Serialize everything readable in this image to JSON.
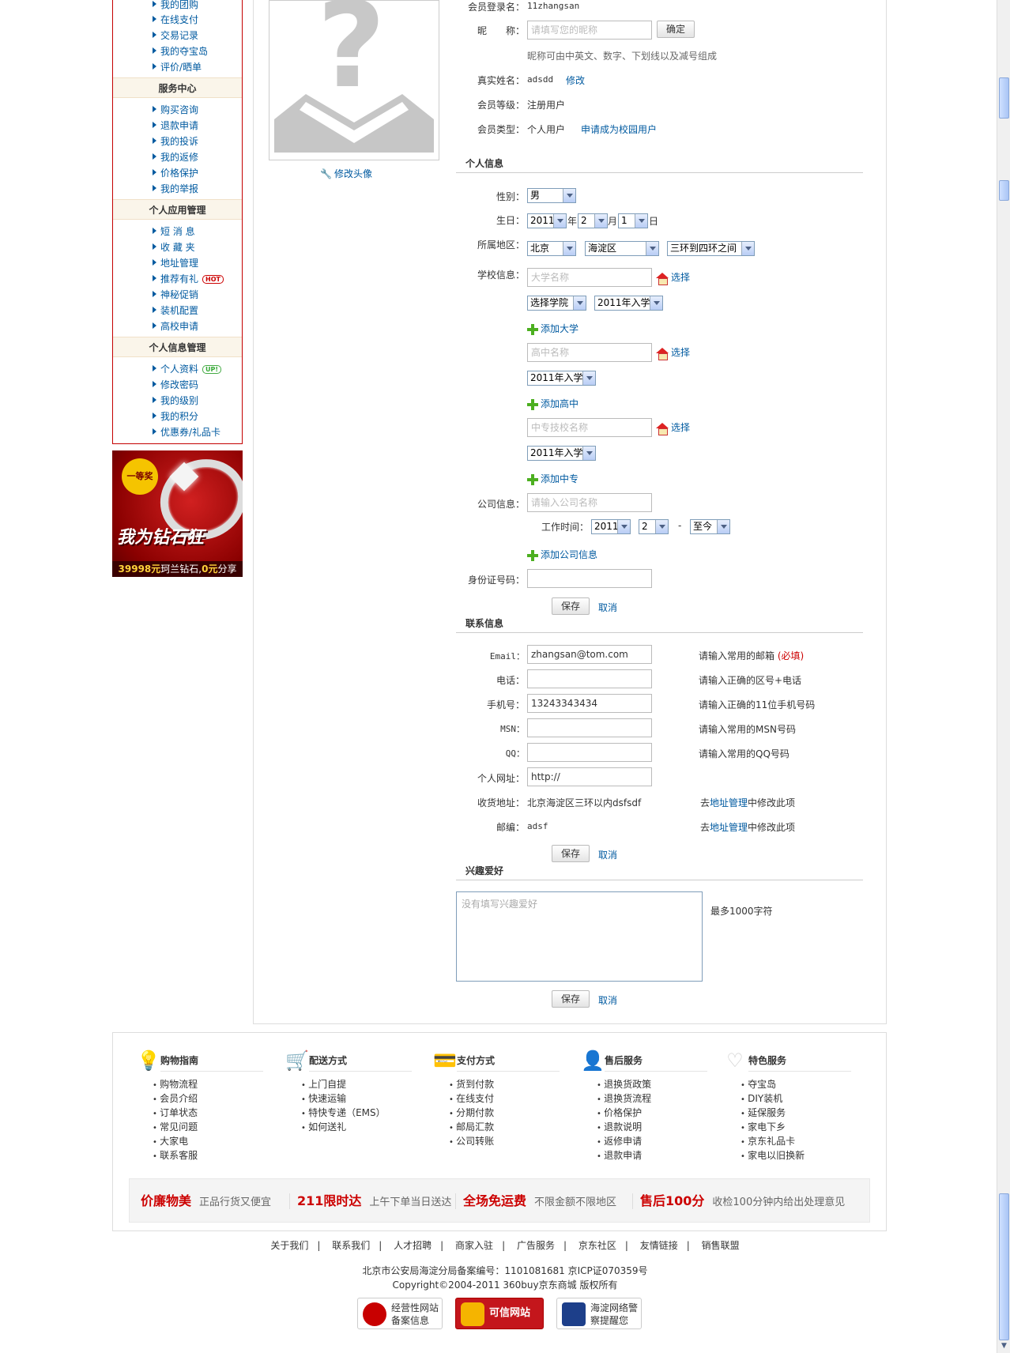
{
  "sidebar": {
    "group0": [
      "我的团购",
      "在线支付",
      "交易记录",
      "我的夺宝岛",
      "评价/晒单"
    ],
    "service_title": "服务中心",
    "service": [
      "购买咨询",
      "退款申请",
      "我的投诉",
      "我的返修",
      "价格保护",
      "我的举报"
    ],
    "app_title": "个人应用管理",
    "app": [
      "短 消 息",
      "收 藏 夹",
      "地址管理",
      "推荐有礼",
      "神秘促销",
      "装机配置",
      "高校申请"
    ],
    "hot_badge": "HOT",
    "info_title": "个人信息管理",
    "info": [
      "个人资料",
      "修改密码",
      "我的级别",
      "我的积分",
      "优惠券/礼品卡"
    ],
    "up_badge": "UP!"
  },
  "ad": {
    "prize": "一等奖",
    "slogan": "我为钻石狂",
    "price": "39998元",
    "mid": "珂兰钻石,",
    "zero": "0元",
    "share": "分享"
  },
  "avatar": {
    "edit_label": "修改头像"
  },
  "account": {
    "login_label": "会员登录名：",
    "login_value": "11zhangsan",
    "nick_label": "昵　　称：",
    "nick_placeholder": "请填写您的昵称",
    "confirm_button": "确定",
    "nick_hint": "昵称可由中英文、数字、下划线以及减号组成",
    "realname_label": "真实姓名：",
    "realname_value": "adsdd",
    "realname_edit": "修改",
    "level_label": "会员等级：",
    "level_value": "注册用户",
    "type_label": "会员类型：",
    "type_value": "个人用户",
    "campus_link": "申请成为校园用户"
  },
  "personal": {
    "title": "个人信息",
    "gender_label": "性别：",
    "gender_value": "男",
    "birthday_label": "生日：",
    "year": "2011",
    "year_unit": "年",
    "month": "2",
    "month_unit": "月",
    "day": "1",
    "day_unit": "日",
    "region_label": "所属地区：",
    "province": "北京",
    "district": "海淀区",
    "area": "三环到四环之间",
    "school_label": "学校信息：",
    "university_placeholder": "大学名称",
    "choose": "选择",
    "college_select": "选择学院",
    "entry_year": "2011年入学",
    "add_university": "添加大学",
    "highschool_placeholder": "高中名称",
    "add_highschool": "添加高中",
    "vocational_placeholder": "中专技校名称",
    "add_vocational": "添加中专",
    "company_label": "公司信息：",
    "company_placeholder": "请输入公司名称",
    "worktime_label": "工作时间：",
    "work_year": "2011",
    "work_month": "2",
    "work_to": "至今",
    "dash": "-",
    "add_company": "添加公司信息",
    "id_label": "身份证号码：",
    "save": "保存",
    "cancel": "取消"
  },
  "contact": {
    "title": "联系信息",
    "email_label": "Email：",
    "email_value": "zhangsan@tom.com",
    "email_hint": "请输入常用的邮箱",
    "required": "(必填)",
    "phone_label": "电话：",
    "phone_hint": "请输入正确的区号+电话",
    "mobile_label": "手机号：",
    "mobile_value": "13243343434",
    "mobile_hint": "请输入正确的11位手机号码",
    "msn_label": "MSN：",
    "msn_hint": "请输入常用的MSN号码",
    "qq_label": "QQ：",
    "qq_hint": "请输入常用的QQ号码",
    "web_label": "个人网址：",
    "web_value": "http://",
    "address_label": "收货地址：",
    "address_value": "北京海淀区三环以内dsfsdf",
    "goto": "去",
    "address_mgmt": "地址管理",
    "edit_here": "中修改此项",
    "zip_label": "邮编：",
    "zip_value": "adsf",
    "save": "保存",
    "cancel": "取消"
  },
  "hobby": {
    "title": "兴趣爱好",
    "placeholder": "没有填写兴趣爱好",
    "limit": "最多1000字符",
    "save": "保存",
    "cancel": "取消"
  },
  "footer": {
    "cols": [
      {
        "title": "购物指南",
        "items": [
          "购物流程",
          "会员介绍",
          "订单状态",
          "常见问题",
          "大家电",
          "联系客服"
        ]
      },
      {
        "title": "配送方式",
        "items": [
          "上门自提",
          "快速运输",
          "特快专递（EMS）",
          "如何送礼"
        ]
      },
      {
        "title": "支付方式",
        "items": [
          "货到付款",
          "在线支付",
          "分期付款",
          "邮局汇款",
          "公司转账"
        ]
      },
      {
        "title": "售后服务",
        "items": [
          "退换货政策",
          "退换货流程",
          "价格保护",
          "退款说明",
          "返修申请",
          "退款申请"
        ]
      },
      {
        "title": "特色服务",
        "items": [
          "夺宝岛",
          "DIY装机",
          "延保服务",
          "家电下乡",
          "京东礼品卡",
          "家电以旧换新"
        ]
      }
    ],
    "promos": [
      {
        "bold": "价廉物美",
        "text": "正品行货又便宜"
      },
      {
        "bold": "211限时达",
        "text": "上午下单当日送达"
      },
      {
        "bold": "全场免运费",
        "text": "不限金额不限地区"
      },
      {
        "bold": "售后100分",
        "text": "收检100分钟内给出处理意见"
      }
    ],
    "links": [
      "关于我们",
      "联系我们",
      "人才招聘",
      "商家入驻",
      "广告服务",
      "京东社区",
      "友情链接",
      "销售联盟"
    ],
    "link_sep": "|",
    "icp": "北京市公安局海淀分局备案编号：1101081681 京ICP证070359号",
    "copyright": "Copyright©2004-2011  360buy京东商城 版权所有",
    "cert1": [
      "经营性网站",
      "备案信息"
    ],
    "cert2": "可信网站",
    "cert3": [
      "海淀网络警",
      "察提醒您"
    ]
  }
}
